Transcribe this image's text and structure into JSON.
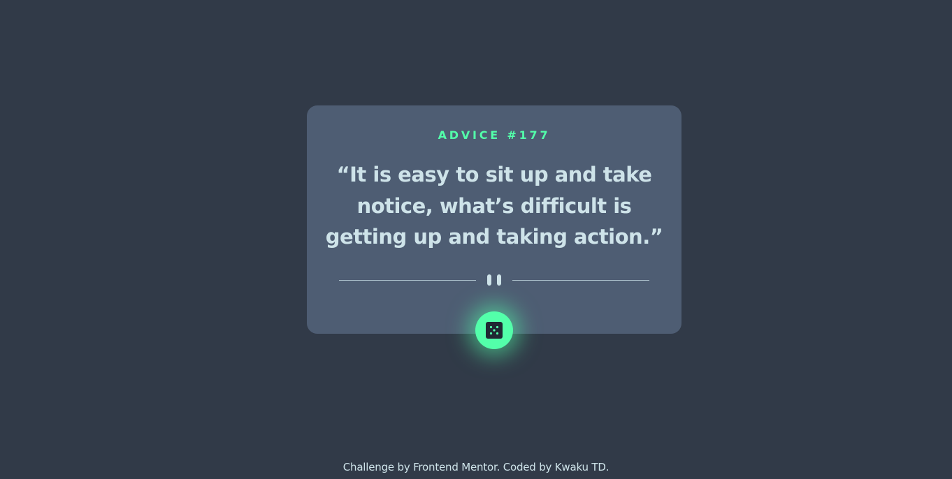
{
  "card": {
    "advice_id": "ADVICE #177",
    "quote": "“It is easy to sit up and take notice, what’s difficult is getting up and taking action.”"
  },
  "button": {
    "icon": "dice-icon"
  },
  "footer": {
    "prefix": "Challenge by ",
    "link1": "Frontend Mentor",
    "middle": ". Coded by ",
    "link2": "Kwaku TD",
    "suffix": "."
  },
  "colors": {
    "background": "#313a48",
    "card": "#4e5d73",
    "accent": "#53ffaa",
    "text": "#cee3e9"
  }
}
